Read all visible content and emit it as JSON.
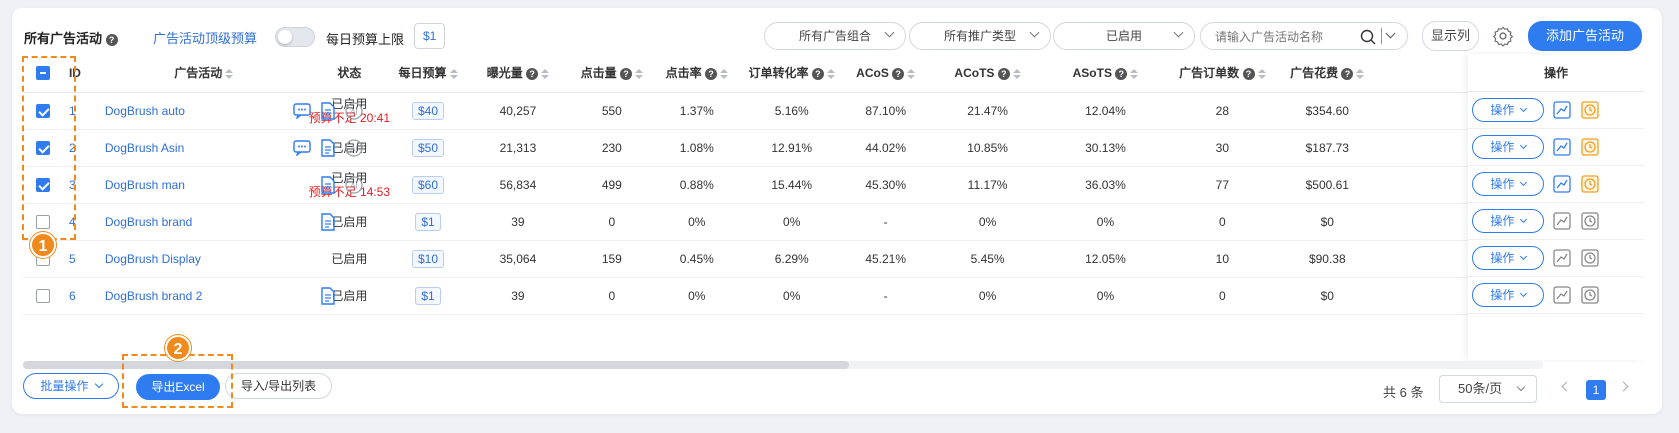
{
  "header": {
    "title": "所有广告活动",
    "top_budget_link": "广告活动顶级预算",
    "daily_cap_label": "每日预算上限",
    "daily_cap_value": "$1",
    "filters": [
      "所有广告组合",
      "所有推广类型",
      "已启用"
    ],
    "search_placeholder": "请输入广告活动名称",
    "show_columns": "显示列",
    "add_campaign": "添加广告活动"
  },
  "columns": {
    "id": "ID",
    "campaign": "广告活动",
    "status": "状态",
    "daily_budget": "每日预算",
    "impressions": "曝光量",
    "clicks": "点击量",
    "ctr": "点击率",
    "cvr": "订单转化率",
    "acos": "ACoS",
    "acots": "ACoTS",
    "asots": "ASoTS",
    "orders": "广告订单数",
    "spend": "广告花费",
    "actions": "操作"
  },
  "rows": [
    {
      "checked": true,
      "id": "1",
      "name": "DogBrush auto",
      "status": "已启用",
      "warning": "预算不足 20:41",
      "budget": "$40",
      "impressions": "40,257",
      "clicks": "550",
      "ctr": "1.37%",
      "cvr": "5.16%",
      "acos": "87.10%",
      "acots": "21.47%",
      "asots": "12.04%",
      "orders": "28",
      "spend": "$354.60",
      "op": "操作",
      "clock_active": true,
      "icons": [
        "chat-icon",
        "doc-icon",
        "ai-icon"
      ]
    },
    {
      "checked": true,
      "id": "2",
      "name": "DogBrush Asin",
      "status": "已启用",
      "warning": "",
      "budget": "$50",
      "impressions": "21,313",
      "clicks": "230",
      "ctr": "1.08%",
      "cvr": "12.91%",
      "acos": "44.02%",
      "acots": "10.85%",
      "asots": "30.13%",
      "orders": "30",
      "spend": "$187.73",
      "op": "操作",
      "clock_active": true,
      "icons": [
        "chat-icon",
        "doc-icon",
        "ai-icon"
      ]
    },
    {
      "checked": true,
      "id": "3",
      "name": "DogBrush man",
      "status": "已启用",
      "warning": "预算不足 14:53",
      "budget": "$60",
      "impressions": "56,834",
      "clicks": "499",
      "ctr": "0.88%",
      "cvr": "15.44%",
      "acos": "45.30%",
      "acots": "11.17%",
      "asots": "36.03%",
      "orders": "77",
      "spend": "$500.61",
      "op": "操作",
      "clock_active": true,
      "icons": [
        "doc-icon",
        "ai-icon"
      ]
    },
    {
      "checked": false,
      "id": "4",
      "name": "DogBrush brand",
      "status": "已启用",
      "warning": "",
      "budget": "$1",
      "impressions": "39",
      "clicks": "0",
      "ctr": "0%",
      "cvr": "0%",
      "acos": "-",
      "acots": "0%",
      "asots": "0%",
      "orders": "0",
      "spend": "$0",
      "op": "操作",
      "clock_active": false,
      "icons": [
        "doc-icon"
      ]
    },
    {
      "checked": false,
      "id": "5",
      "name": "DogBrush Display",
      "status": "已启用",
      "warning": "",
      "budget": "$10",
      "impressions": "35,064",
      "clicks": "159",
      "ctr": "0.45%",
      "cvr": "6.29%",
      "acos": "45.21%",
      "acots": "5.45%",
      "asots": "12.05%",
      "orders": "10",
      "spend": "$90.38",
      "op": "操作",
      "clock_active": false,
      "icons": []
    },
    {
      "checked": false,
      "id": "6",
      "name": "DogBrush brand 2",
      "status": "已启用",
      "warning": "",
      "budget": "$1",
      "impressions": "39",
      "clicks": "0",
      "ctr": "0%",
      "cvr": "0%",
      "acos": "-",
      "acots": "0%",
      "asots": "0%",
      "orders": "0",
      "spend": "$0",
      "op": "操作",
      "clock_active": false,
      "icons": [
        "doc-icon"
      ]
    }
  ],
  "footer": {
    "batch": "批量操作",
    "export_excel": "导出Excel",
    "import_export": "导入/导出列表",
    "total": "共 6 条",
    "page_size": "50条/页",
    "current_page": "1"
  },
  "callouts": [
    "1",
    "2"
  ],
  "colors": {
    "primary": "#2f7cf0",
    "link": "#2f6fd6",
    "warning": "#e02020",
    "callout": "#f08a1c",
    "clock_active": "#f0a020"
  }
}
